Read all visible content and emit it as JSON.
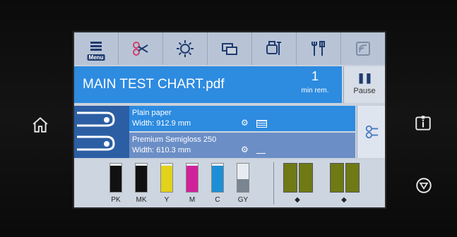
{
  "toolbar": {
    "items": [
      {
        "name": "menu-icon",
        "label": "Menu"
      },
      {
        "name": "scissors-icon",
        "label": ""
      },
      {
        "name": "settings-icon",
        "label": ""
      },
      {
        "name": "windows-icon",
        "label": ""
      },
      {
        "name": "printer-maintenance-icon",
        "label": ""
      },
      {
        "name": "tools-icon",
        "label": ""
      },
      {
        "name": "wifi-icon",
        "label": ""
      }
    ]
  },
  "job": {
    "name": "MAIN TEST CHART.pdf",
    "remaining_value": "1",
    "remaining_unit": "min rem.",
    "pause_label": "Pause"
  },
  "paper": {
    "roll1": {
      "type": "Plain paper",
      "width": "Width: 912.9 mm"
    },
    "roll2": {
      "type": "Premium Semigloss 250",
      "width": "Width: 610.3 mm"
    }
  },
  "inks": [
    {
      "label": "PK",
      "color": "#111111",
      "level": 0.93
    },
    {
      "label": "MK",
      "color": "#111111",
      "level": 0.93
    },
    {
      "label": "Y",
      "color": "#e2d21a",
      "level": 0.93
    },
    {
      "label": "M",
      "color": "#d0219a",
      "level": 0.93
    },
    {
      "label": "C",
      "color": "#1d8fd6",
      "level": 0.93
    },
    {
      "label": "GY",
      "color": "#7a8592",
      "level": 0.45
    }
  ],
  "maintenance": [
    {
      "label": "▲"
    },
    {
      "label": "▲"
    }
  ],
  "colors": {
    "accent": "#2d8be0",
    "toolbar": "#b8c4d6",
    "panel": "#cdd5e0"
  }
}
